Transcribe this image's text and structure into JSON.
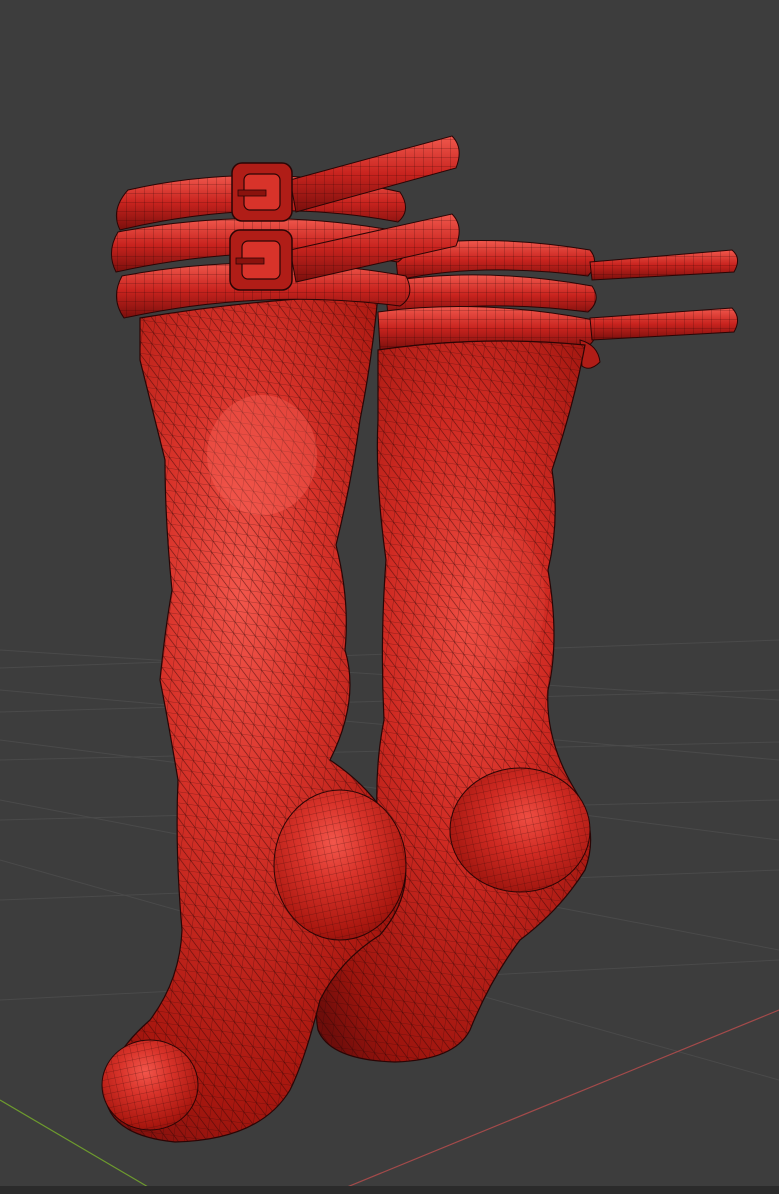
{
  "viewport": {
    "background_color": "#3d3d3d",
    "grid_color": "#4a4a4a",
    "axis_x_color": "#a34a4a",
    "axis_y_color": "#6d9a2e"
  },
  "model": {
    "mesh_color": "#c8231e",
    "mesh_highlight": "#f0544a",
    "mesh_shadow": "#7a0f0c",
    "wire_color": "#2a0505"
  }
}
